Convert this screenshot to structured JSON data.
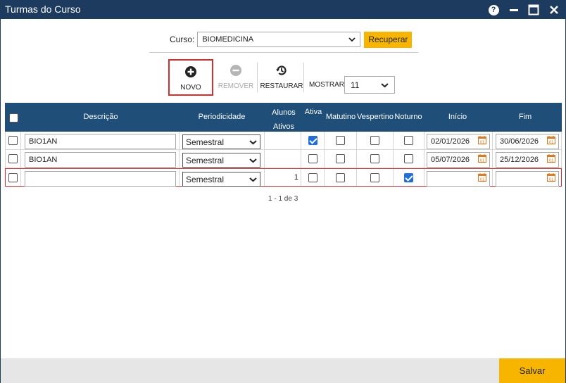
{
  "window": {
    "title": "Turmas do Curso"
  },
  "curso": {
    "label": "Curso:",
    "selected": "BIOMEDICINA",
    "recuperar_label": "Recuperar"
  },
  "toolbar": {
    "novo_label": "NOVO",
    "remover_label": "REMOVER",
    "restaurar_label": "RESTAURAR",
    "mostrar_label": "MOSTRAR:",
    "mostrar_value": "11"
  },
  "grid": {
    "headers": {
      "descricao": "Descrição",
      "periodicidade": "Periodicidade",
      "alunos_line1": "Alunos",
      "alunos_line2": "Ativos",
      "ativa": "Ativa",
      "matutino": "Matutino",
      "vespertino": "Vespertino",
      "noturno": "Noturno",
      "inicio": "Início",
      "fim": "Fim"
    },
    "rows": [
      {
        "descricao": "BIO1AN",
        "periodicidade": "Semestral",
        "alunos": "",
        "ativa": true,
        "matutino": false,
        "vespertino": false,
        "noturno": false,
        "inicio": "02/01/2026",
        "fim": "30/06/2026"
      },
      {
        "descricao": "BIO1AN",
        "periodicidade": "Semestral",
        "alunos": "",
        "ativa": false,
        "matutino": false,
        "vespertino": false,
        "noturno": false,
        "inicio": "05/07/2026",
        "fim": "25/12/2026"
      },
      {
        "descricao": "",
        "periodicidade": "Semestral",
        "alunos": "1",
        "ativa": false,
        "matutino": false,
        "vespertino": false,
        "noturno": true,
        "inicio": "",
        "fim": ""
      }
    ],
    "pager": "1 - 1 de 3"
  },
  "footer": {
    "salvar_label": "Salvar"
  },
  "colors": {
    "titlebar": "#1c3b5e",
    "header": "#1f4e79",
    "accent": "#f7b500",
    "selection": "#d32f2f",
    "check": "#1e6fd9"
  }
}
